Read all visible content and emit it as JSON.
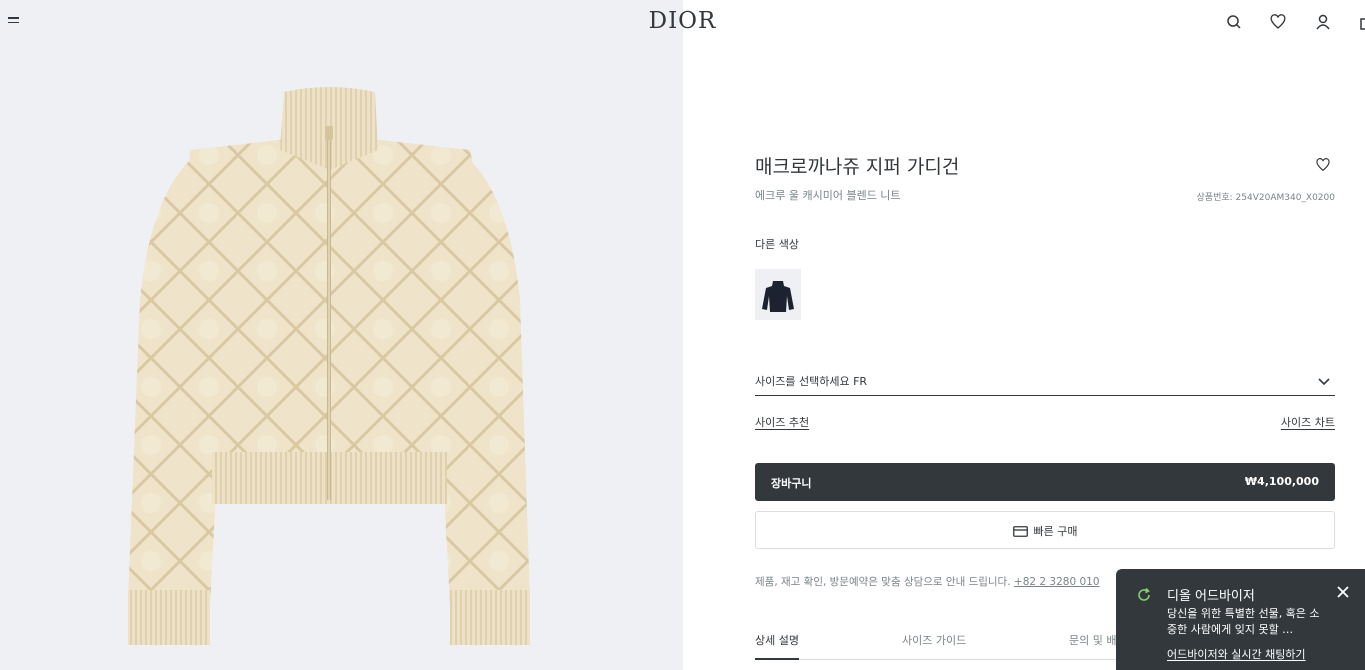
{
  "header": {
    "logo": "DIOR",
    "icons": [
      "menu-icon",
      "search-icon",
      "heart-icon",
      "user-icon",
      "bag-icon"
    ]
  },
  "product": {
    "title": "매크로까나쥬 지퍼 가디건",
    "subtitle": "에크루 울 캐시미어 블렌드 니트",
    "sku": "상품번호: 254V20AM340_X0200",
    "other_colors_label": "다른 색상",
    "size_select_label": "사이즈를 선택하세요 FR",
    "size_recommend": "사이즈 추천",
    "size_chart": "사이즈 차트",
    "cart_label": "장바구니",
    "price": "₩4,100,000",
    "quick_buy": "빠른 구매",
    "notice": "제품, 재고 확인, 방문예약은 맞춤 상담으로 안내 드립니다.",
    "phone": "+82 2 3280 010",
    "tabs": [
      "상세 설명",
      "사이즈 가이드",
      "문의 및 배"
    ]
  },
  "chat": {
    "title": "디올 어드바이저",
    "message": "당신을 위한 특별한 선물, 혹은 소중한 사람에게 잊지 못할 …",
    "cta": "어드바이저와 실시간 채팅하기"
  },
  "colors": {
    "dark": "#33383c",
    "grey_bg": "#eef0f3",
    "knit": "#eee3c9"
  }
}
